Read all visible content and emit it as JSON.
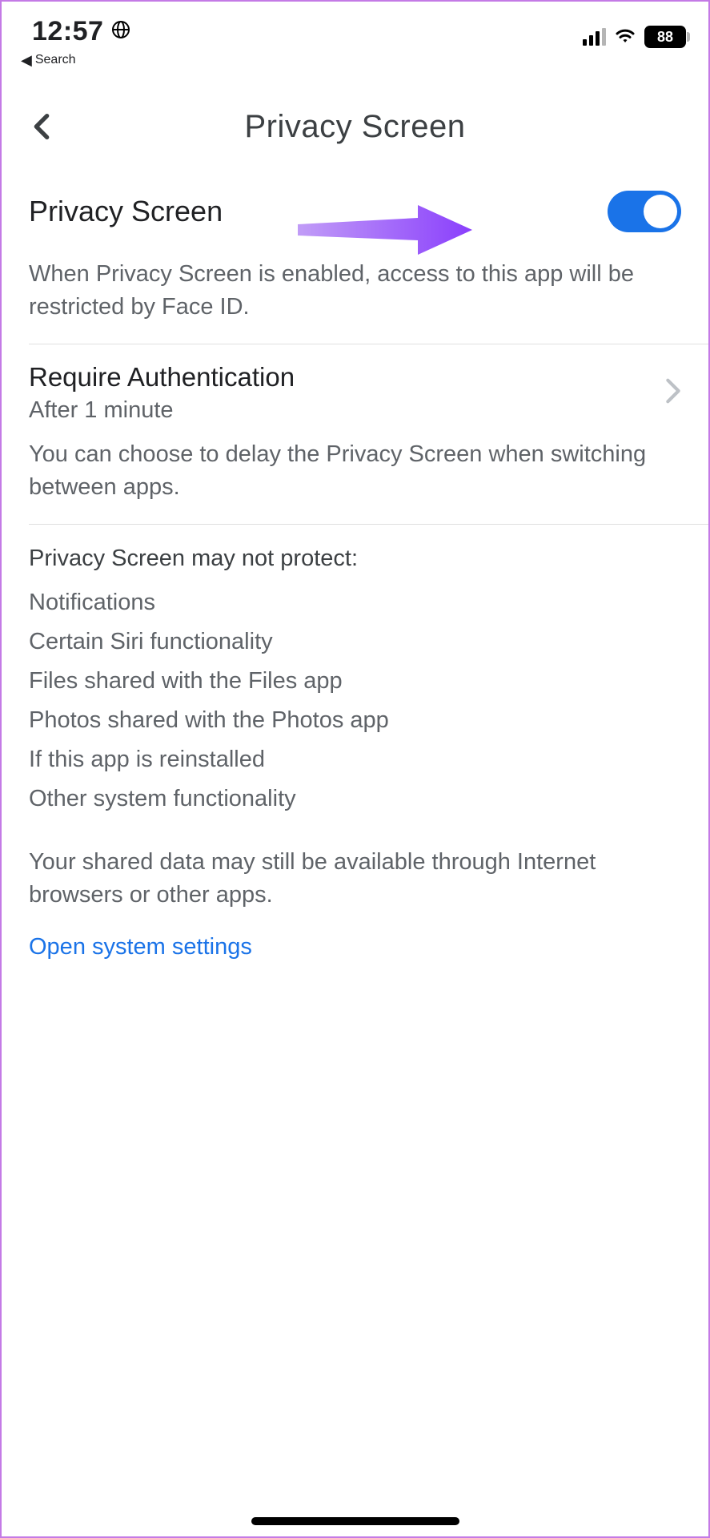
{
  "status": {
    "time": "12:57",
    "battery": "88",
    "back_label": "Search"
  },
  "header": {
    "title": "Privacy Screen"
  },
  "privacy_toggle": {
    "label": "Privacy Screen",
    "enabled": true,
    "description": "When Privacy Screen is enabled, access to this app will be restricted by Face ID."
  },
  "require_auth": {
    "label": "Require Authentication",
    "value": "After 1 minute",
    "description": "You can choose to delay the Privacy Screen when switching between apps."
  },
  "limitations": {
    "header": "Privacy Screen may not protect:",
    "items": [
      "Notifications",
      "Certain Siri functionality",
      "Files shared with the Files app",
      "Photos shared with the Photos app",
      "If this app is reinstalled",
      "Other system functionality"
    ],
    "footer": "Your shared data may still be available through Internet browsers or other apps."
  },
  "link": {
    "label": "Open system settings"
  },
  "annotation": {
    "arrow_color": "#8a3ffc"
  }
}
